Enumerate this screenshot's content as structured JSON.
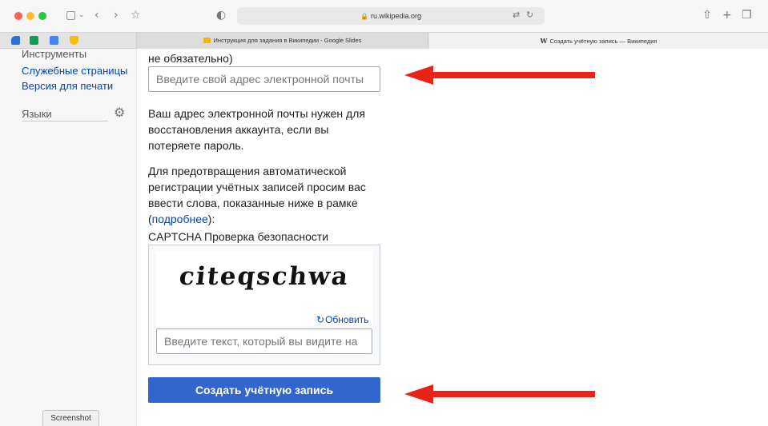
{
  "browser": {
    "url": "ru.wikipedia.org",
    "tabs": [
      {
        "title": "Инструкция для задания в Википедии - Google Slides"
      },
      {
        "title": "Создать учётную запись — Википедия"
      }
    ]
  },
  "sidebar": {
    "tools_heading": "Инструменты",
    "links": [
      "Служебные страницы",
      "Версия для печати"
    ],
    "languages_heading": "Языки"
  },
  "form": {
    "email_label_tail": "не обязательно)",
    "email_placeholder": "Введите свой адрес электронной почты",
    "email_help": [
      "Ваш адрес электронной почты нужен для",
      "восстановления аккаунта, если вы",
      "потеряете пароль."
    ],
    "captcha_help": [
      "Для предотвращения автоматической",
      "регистрации учётных записей просим вас",
      "ввести слова, показанные ниже в рамке"
    ],
    "captcha_help_open": "(",
    "captcha_more_link": "подробнее",
    "captcha_help_close": "):",
    "captcha_title": "CAPTCHA Проверка безопасности",
    "captcha_word": "citeqschwa",
    "refresh_label": "Обновить",
    "captcha_placeholder": "Введите текст, который вы видите на",
    "submit_label": "Создать учётную запись"
  },
  "overlay": {
    "screenshot_label": "Screenshot",
    "arrow_color": "#e8231a"
  }
}
